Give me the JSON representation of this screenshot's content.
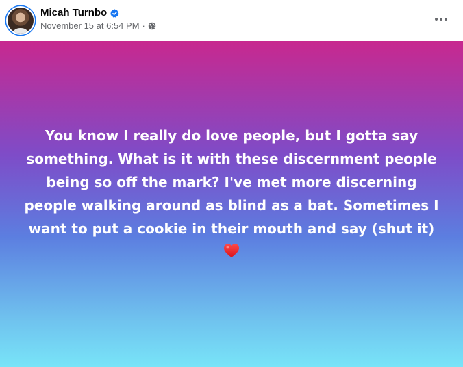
{
  "post": {
    "author": "Micah Turnbo",
    "timestamp": "November 15 at 6:54 PM",
    "separator": "·",
    "text": "You know I really do love people, but I gotta say something. What is it with these discernment people being so off the mark? I've met more discerning people walking around as blind as a bat. Sometimes I want to put a cookie in their mouth and say (shut it)",
    "emoji_icon": "red-heart-icon",
    "audience_icon": "globe-icon",
    "verified_icon": "verified-badge-icon"
  },
  "colors": {
    "gradient_top": "#c8288f",
    "gradient_bottom": "#78e4f8",
    "verified_blue": "#1877f2",
    "meta_gray": "#65676b"
  }
}
